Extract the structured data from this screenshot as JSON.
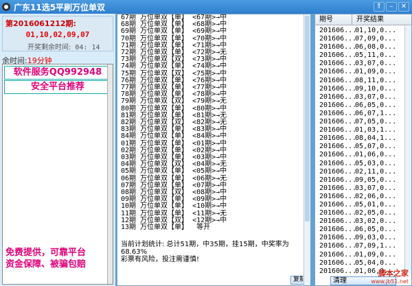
{
  "window": {
    "title": "广东11选5平刷万位单双"
  },
  "info": {
    "period_label": "第2016061212期:",
    "numbers": "01,10,02,09,07",
    "countdown_label": "开奖剩余时间:",
    "countdown_value": "04: 14"
  },
  "remaining": {
    "label": "余时间:",
    "value": "19分钟"
  },
  "ads": {
    "line1": "软件服务QQ992948",
    "line2": "安全平台推荐",
    "line3": "免费提供，可靠平台",
    "line4": "资金保障、被骗包赔"
  },
  "plan_lines": [
    "67期 万位单双【单】 <67期>→中",
    "68期 万位单双【单】 <68期>→中",
    "69期 万位单双【单】 <69期>→中",
    "70期 万位单双【单】 <70期>→中",
    "71期 万位单双【单】 <71期>→中",
    "72期 万位单双【单】 <72期>→无",
    "73期 万位单双【双】 <73期>→中",
    "74期 万位单双【单】 <74期>→中",
    "75期 万位单双【双】 <75期>→中",
    "76期 万位单双【单】 <76期>→中",
    "77期 万位单双【单】 <77期>→中",
    "78期 万位单双【单】 <78期>→中",
    "79期 万位单双【双】 <79期>→无",
    "80期 万位单双【单】 <80期>→中",
    "81期 万位单双【单】 <81期>→无",
    "82期 万位单双【双】 <82期>→无",
    "83期 万位单双【单】 <83期>→中",
    "84期 万位单双【单】 <84期>→中",
    "01期 万位单双【单】 <01期>→中",
    "02期 万位单双【单】 <02期>→中",
    "03期 万位单双【单】 <03期>→中",
    "04期 万位单双【双】 <04期>→无",
    "05期 万位单双【单】 <05期>→中",
    "06期 万位单双【单】 <06期>→无",
    "07期 万位单双【单】 <07期>→中",
    "08期 万位单双【双】 <08期>→中",
    "09期 万位单双【单】 <09期>→中",
    "10期 万位单双【单】 <10期>→中",
    "11期 万位单双【单】 <11期>→无",
    "12期 万位单双【双】 <12期>→中",
    "13期 万位单双【单】  等开"
  ],
  "stats": {
    "line1": "当前计划统计: 总计51期，中35期，挂15期，中奖率为68.63%",
    "line2": "彩票有风险，投注需谨慎!"
  },
  "buttons": {
    "copy": "复制",
    "clear": "清理"
  },
  "history": {
    "col_period": "期号",
    "col_result": "开奖结果",
    "rows": [
      {
        "p": "201606...",
        "r": "01,10,0..."
      },
      {
        "p": "201606...",
        "r": "07,09,0..."
      },
      {
        "p": "201606...",
        "r": "06,08,0..."
      },
      {
        "p": "201606...",
        "r": "05,11,0..."
      },
      {
        "p": "201606...",
        "r": "03,07,0..."
      },
      {
        "p": "201606...",
        "r": "01,09,0..."
      },
      {
        "p": "201606...",
        "r": "08,11,0..."
      },
      {
        "p": "201606...",
        "r": "09,10,0..."
      },
      {
        "p": "201606...",
        "r": "03,07,0..."
      },
      {
        "p": "201606...",
        "r": "06,05,0..."
      },
      {
        "p": "201606...",
        "r": "06,07,1..."
      },
      {
        "p": "201606...",
        "r": "07,05,0..."
      },
      {
        "p": "201606...",
        "r": "01,03,1..."
      },
      {
        "p": "201606...",
        "r": "08,04,1..."
      },
      {
        "p": "201606...",
        "r": "05,07,0..."
      },
      {
        "p": "201606...",
        "r": "01,06,0..."
      },
      {
        "p": "201606...",
        "r": "05,03,0..."
      },
      {
        "p": "201606...",
        "r": "02,11,0..."
      },
      {
        "p": "201606...",
        "r": "09,05,0..."
      },
      {
        "p": "201606...",
        "r": "03,07,0..."
      },
      {
        "p": "201606...",
        "r": "02,06,0..."
      },
      {
        "p": "201606...",
        "r": "05,01,0..."
      },
      {
        "p": "201606...",
        "r": "02,05,0..."
      },
      {
        "p": "201606...",
        "r": "03,02,0..."
      },
      {
        "p": "201606...",
        "r": "06,05,0..."
      },
      {
        "p": "201606...",
        "r": "09,03,0..."
      },
      {
        "p": "201606...",
        "r": "07,09,1..."
      },
      {
        "p": "201606...",
        "r": "01,09,0..."
      },
      {
        "p": "201606...",
        "r": "05,04,0..."
      },
      {
        "p": "201606...",
        "r": "01,06,0..."
      }
    ]
  },
  "watermark": {
    "main": "脚本之家",
    "sub": "www.jb51.net"
  }
}
